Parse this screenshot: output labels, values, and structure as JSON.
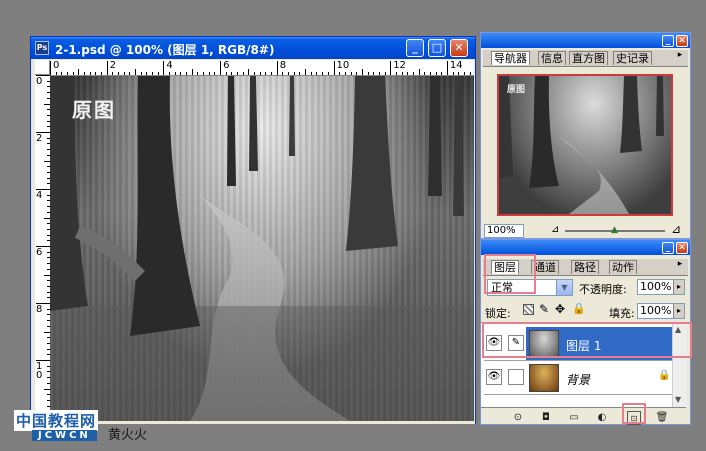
{
  "document": {
    "title": "2-1.psd @ 100% (图层 1, RGB/8#)",
    "watermark_text": "原图",
    "ruler_h": [
      "0",
      "2",
      "4",
      "6",
      "8",
      "10",
      "12",
      "14"
    ],
    "ruler_v": [
      "0",
      "2",
      "4",
      "6",
      "8",
      "1 0"
    ]
  },
  "navigator_panel": {
    "tabs": [
      "导航器",
      "信息",
      "直方图",
      "史记录"
    ],
    "active_tab": "导航器",
    "zoom": "100%",
    "preview_mark": "原图"
  },
  "layers_panel": {
    "tabs": [
      "图层",
      "通道",
      "路径",
      "动作"
    ],
    "active_tab": "图层",
    "blend_mode": "正常",
    "opacity_label": "不透明度:",
    "opacity_value": "100%",
    "lock_label": "锁定:",
    "fill_label": "填充:",
    "fill_value": "100%",
    "layers": [
      {
        "name": "图层 1",
        "selected": true
      },
      {
        "name": "背景",
        "selected": false,
        "locked": true
      }
    ]
  },
  "footer_logo": {
    "cn": "中国教程网",
    "en": "JCWCN",
    "author": "黄火火"
  },
  "colors": {
    "xp_title": "#0050dd",
    "highlight": "#e57f8e",
    "selected_layer": "#316ac5",
    "logo_blue": "#1f5fa8"
  }
}
